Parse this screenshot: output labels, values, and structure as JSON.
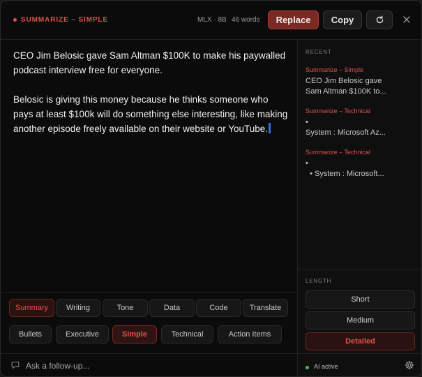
{
  "header": {
    "mode_label": "SUMMARIZE – SIMPLE",
    "model": "MLX · 8B",
    "word_count": "46 words",
    "replace_label": "Replace",
    "copy_label": "Copy"
  },
  "output": {
    "paragraph1": "CEO Jim Belosic gave Sam Altman $100K to make his paywalled podcast interview free for everyone.",
    "paragraph2": "Belosic is giving this money because he thinks someone who pays at least $100k will do something else interesting, like making another episode freely available on their website or YouTube."
  },
  "sidebar": {
    "recent_label": "RECENT",
    "recent": [
      {
        "tag": "Summarize – Simple",
        "text": "CEO Jim Belosic gave\nSam Altman $100K to..."
      },
      {
        "tag": "Summarize – Technical",
        "text": "•\nSystem : Microsoft Az..."
      },
      {
        "tag": "Summarize – Technical",
        "text": "•\n  • System : Microsoft..."
      }
    ],
    "length_label": "LENGTH",
    "length_options": [
      "Short",
      "Medium",
      "Detailed"
    ],
    "length_selected": "Detailed",
    "status": "AI active"
  },
  "chips": {
    "row1": [
      "Summary",
      "Writing",
      "Tone",
      "Data",
      "Code",
      "Translate"
    ],
    "row1_selected": "Summary",
    "row2": [
      "Bullets",
      "Executive",
      "Simple",
      "Technical",
      "Action Items"
    ],
    "row2_selected": "Simple"
  },
  "followup": {
    "placeholder": "Ask a follow-up..."
  },
  "icons": {
    "refresh": "refresh-icon",
    "close": "close-icon",
    "chat": "chat-bubble-icon",
    "settings": "gear-icon"
  },
  "colors": {
    "accent": "#d9534a",
    "accent_dark": "#7a2a24",
    "status_green": "#3fbf58",
    "caret": "#3b6fd8"
  }
}
